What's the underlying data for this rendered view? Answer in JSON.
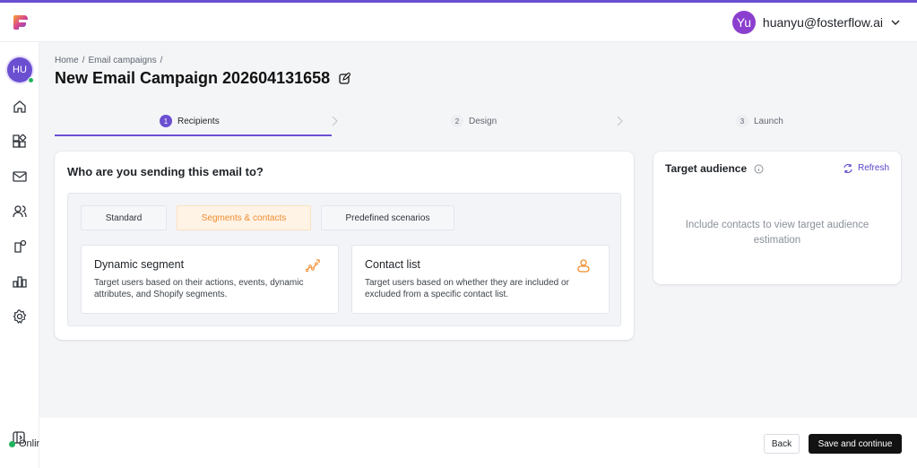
{
  "header": {
    "user_initials": "Yu",
    "user_email": "huanyu@fosterflow.ai"
  },
  "sidebar": {
    "avatar_initials": "HU",
    "status_label": "Online",
    "items": [
      "home-icon",
      "widgets-icon",
      "mail-icon",
      "users-icon",
      "integrations-icon",
      "analytics-icon",
      "settings-icon"
    ]
  },
  "breadcrumb": {
    "home": "Home",
    "sep": "/",
    "section": "Email campaigns"
  },
  "page": {
    "title": "New Email Campaign 202604131658"
  },
  "steps": [
    {
      "num": "1",
      "label": "Recipients"
    },
    {
      "num": "2",
      "label": "Design"
    },
    {
      "num": "3",
      "label": "Launch"
    }
  ],
  "recipients": {
    "question": "Who are you sending this email to?",
    "tabs": [
      "Standard",
      "Segments & contacts",
      "Predefined scenarios"
    ],
    "options": [
      {
        "title": "Dynamic segment",
        "desc": "Target users based on their actions, events, dynamic attributes, and Shopify segments."
      },
      {
        "title": "Contact list",
        "desc": "Target users based on whether they are included or excluded from a specific contact list."
      }
    ]
  },
  "audience": {
    "title": "Target audience",
    "refresh": "Refresh",
    "empty": "Include contacts to view target audience estimation"
  },
  "footer": {
    "back": "Back",
    "save": "Save and continue"
  },
  "colors": {
    "accent": "#6b4fd1",
    "orange": "#f08c2e",
    "online": "#22b35e"
  }
}
